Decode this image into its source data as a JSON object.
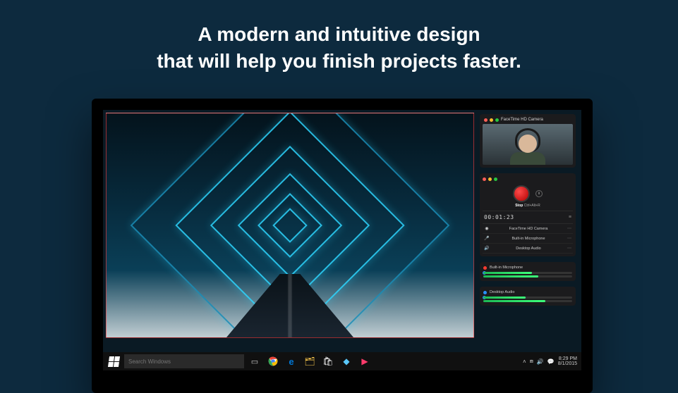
{
  "hero": {
    "line1": "A modern and intuitive design",
    "line2": "that will help you finish projects faster."
  },
  "camera_panel": {
    "title": "FaceTime HD Camera"
  },
  "recorder": {
    "stop_label": "Stop",
    "shortcut": "Ctrl+Alt+R",
    "timer": "00:01:23",
    "sources": [
      {
        "icon": "◉",
        "name": "FaceTime HD Camera"
      },
      {
        "icon": "🎤",
        "name": "Built-in Microphone"
      },
      {
        "icon": "🔊",
        "name": "Desktop Audio"
      }
    ]
  },
  "meters": [
    {
      "name": "Built-in Microphone",
      "levels": [
        55,
        62
      ]
    },
    {
      "name": "Desktop Audio",
      "levels": [
        48,
        70
      ]
    }
  ],
  "taskbar": {
    "search_placeholder": "Search Windows",
    "time": "8:29 PM",
    "date": "8/1/2015"
  }
}
